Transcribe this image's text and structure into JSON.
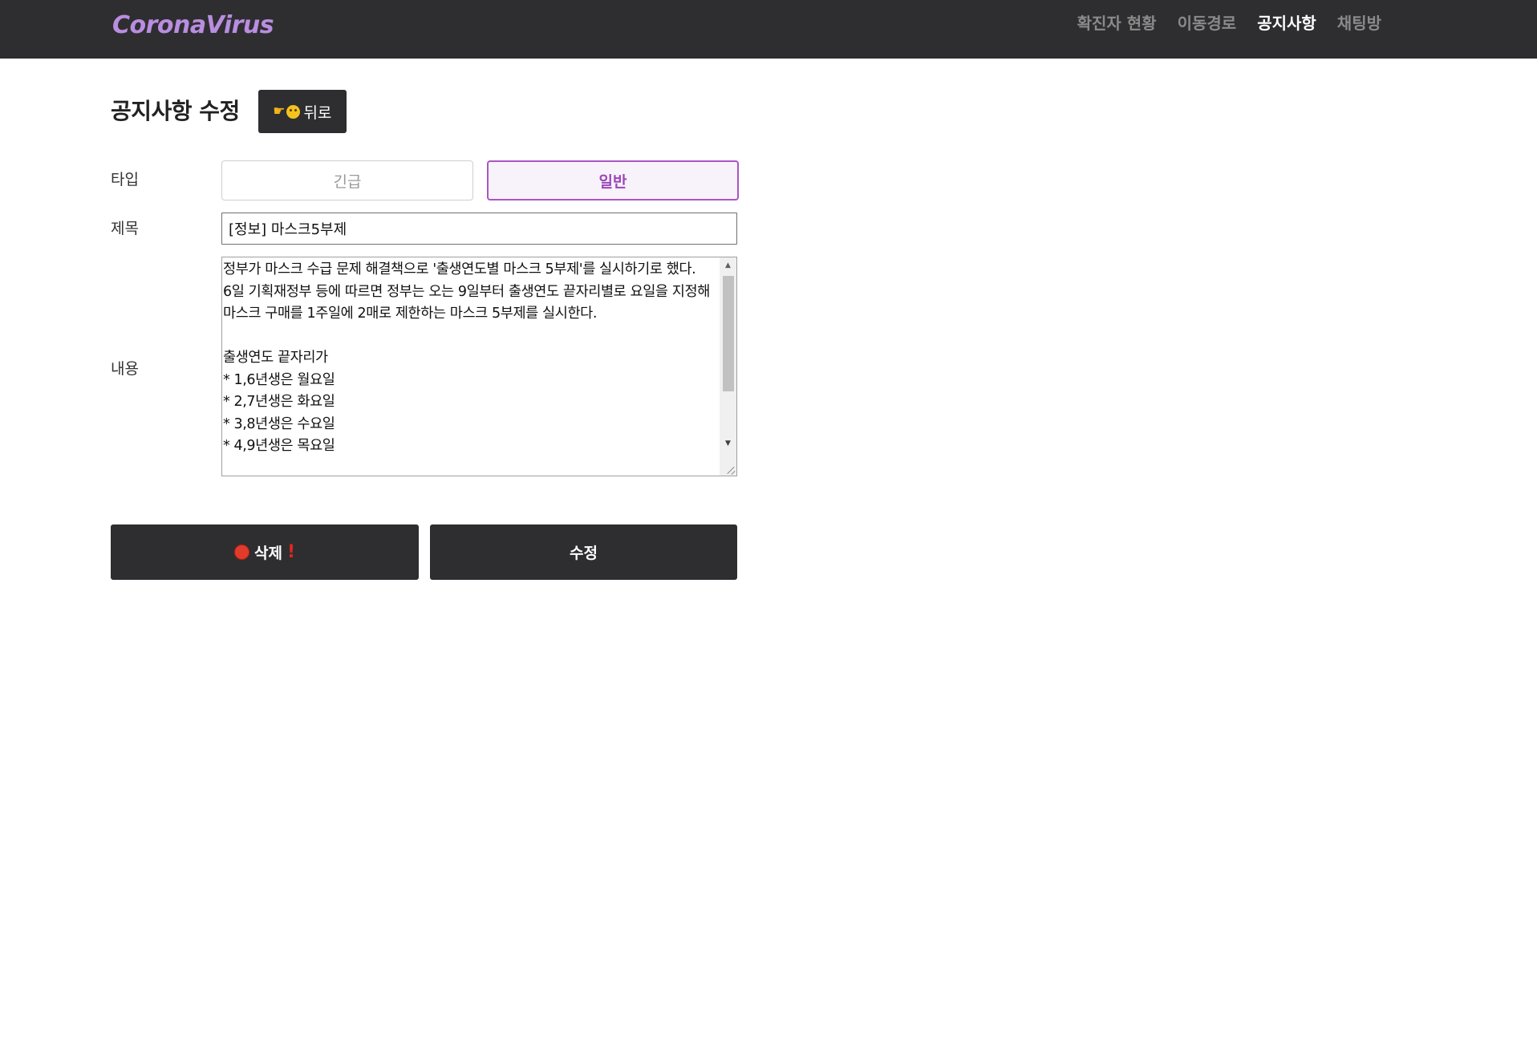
{
  "navbar": {
    "brand": "CoronaVirus",
    "links": [
      {
        "label": "확진자 현황",
        "active": false
      },
      {
        "label": "이동경로",
        "active": false
      },
      {
        "label": "공지사항",
        "active": true
      },
      {
        "label": "채팅방",
        "active": false
      }
    ]
  },
  "page": {
    "title": "공지사항 수정",
    "back_label": "뒤로",
    "back_icons": [
      "hand-pointing-icon",
      "flushed-face-icon"
    ]
  },
  "form": {
    "type_label": "타입",
    "type_options": [
      {
        "label": "긴급",
        "selected": false
      },
      {
        "label": "일반",
        "selected": true
      }
    ],
    "title_label": "제목",
    "title_value": "[정보] 마스크5부제",
    "content_label": "내용",
    "content_value": "정부가 마스크 수급 문제 해결책으로 '출생연도별 마스크 5부제'를 실시하기로 했다.\n6일 기획재정부 등에 따르면 정부는 오는 9일부터 출생연도 끝자리별로 요일을 지정해 마스크 구매를 1주일에 2매로 제한하는 마스크 5부제를 실시한다.\n\n출생연도 끝자리가\n* 1,6년생은 월요일\n* 2,7년생은 화요일\n* 3,8년생은 수요일\n* 4,9년생은 목요일"
  },
  "actions": {
    "delete_label": "삭제",
    "delete_icons": [
      "red-circle-icon",
      "exclamation-icon"
    ],
    "edit_label": "수정"
  },
  "colors": {
    "navbar_bg": "#2e2e30",
    "brand": "#b98de0",
    "accent": "#a856c4",
    "button_bg": "#2e2e30"
  }
}
